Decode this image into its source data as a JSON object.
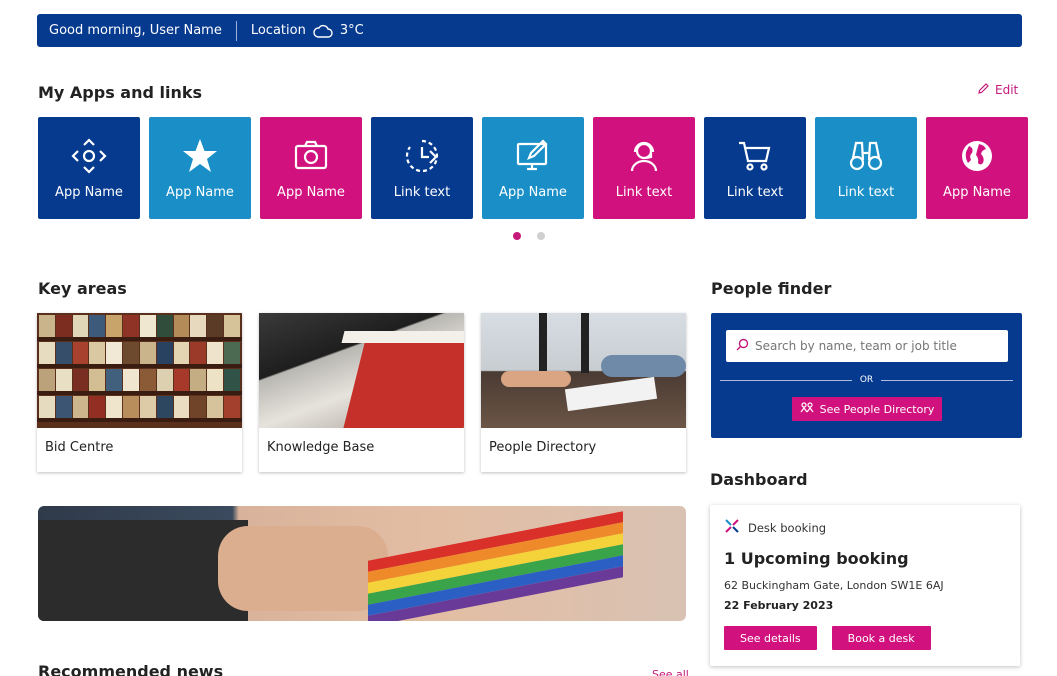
{
  "topbar": {
    "greeting": "Good morning, User Name",
    "location_label": "Location",
    "weather_icon": "cloud-icon",
    "temperature": "3°C"
  },
  "apps_section": {
    "title": "My Apps and links",
    "edit_label": "Edit",
    "tiles": [
      {
        "label": "App Name",
        "icon": "navigation-arrows-icon",
        "color": "#063a8f"
      },
      {
        "label": "App Name",
        "icon": "star-icon",
        "color": "#1a8fc7"
      },
      {
        "label": "App Name",
        "icon": "camera-icon",
        "color": "#d1127e"
      },
      {
        "label": "Link text",
        "icon": "timer-icon",
        "color": "#063a8f"
      },
      {
        "label": "App Name",
        "icon": "monitor-edit-icon",
        "color": "#1a8fc7"
      },
      {
        "label": "Link text",
        "icon": "headset-icon",
        "color": "#d1127e"
      },
      {
        "label": "Link text",
        "icon": "shopping-cart-icon",
        "color": "#063a8f"
      },
      {
        "label": "Link text",
        "icon": "binoculars-icon",
        "color": "#1a8fc7"
      },
      {
        "label": "App Name",
        "icon": "globe-icon",
        "color": "#d1127e"
      }
    ],
    "pagination": {
      "pages": 2,
      "current": 1
    }
  },
  "key_areas": {
    "title": "Key areas",
    "cards": [
      {
        "label": "Bid Centre"
      },
      {
        "label": "Knowledge Base"
      },
      {
        "label": "People Directory"
      }
    ]
  },
  "people_finder": {
    "title": "People finder",
    "search_placeholder": "Search by name, team or job title",
    "or_label": "OR",
    "directory_button": "See People Directory"
  },
  "dashboard": {
    "title": "Dashboard",
    "widget_label": "Desk booking",
    "booking_count": "1 Upcoming booking",
    "address": "62 Buckingham Gate, London SW1E 6AJ",
    "date": "22 February 2023",
    "details_button": "See details",
    "book_button": "Book a desk"
  },
  "news": {
    "title": "Recommended news",
    "see_all": "See all"
  },
  "colors": {
    "navy": "#063a8f",
    "blue": "#1a8fc7",
    "pink": "#d1127e"
  }
}
